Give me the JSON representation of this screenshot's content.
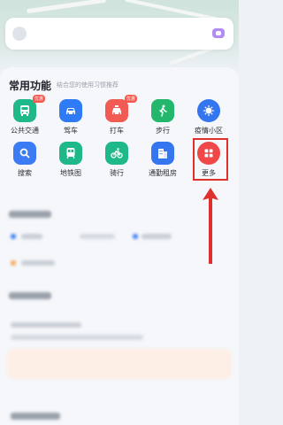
{
  "search": {
    "placeholder": ""
  },
  "common_functions": {
    "title": "常用功能",
    "subtitle": "结合您的使用习惯推荐",
    "items": [
      {
        "label": "公共交通",
        "icon": "bus-icon",
        "color": "#1fb889",
        "badge": "优惠"
      },
      {
        "label": "驾车",
        "icon": "car-icon",
        "color": "#2f7bf5",
        "badge": ""
      },
      {
        "label": "打车",
        "icon": "taxi-icon",
        "color": "#f25a54",
        "badge": "优惠"
      },
      {
        "label": "步行",
        "icon": "walk-icon",
        "color": "#22b76b",
        "badge": ""
      },
      {
        "label": "疫情小区",
        "icon": "virus-icon",
        "color": "#3476f0",
        "badge": ""
      },
      {
        "label": "搜索",
        "icon": "search-icon",
        "color": "#3b7cf4",
        "badge": ""
      },
      {
        "label": "地铁图",
        "icon": "subway-icon",
        "color": "#1fb889",
        "badge": ""
      },
      {
        "label": "骑行",
        "icon": "bike-icon",
        "color": "#1fb889",
        "badge": ""
      },
      {
        "label": "通勤租房",
        "icon": "building-icon",
        "color": "#3476f0",
        "badge": ""
      },
      {
        "label": "更多",
        "icon": "grid-icon",
        "color": "#f04848",
        "badge": ""
      }
    ]
  },
  "colors": {
    "highlight": "#e0302d"
  }
}
